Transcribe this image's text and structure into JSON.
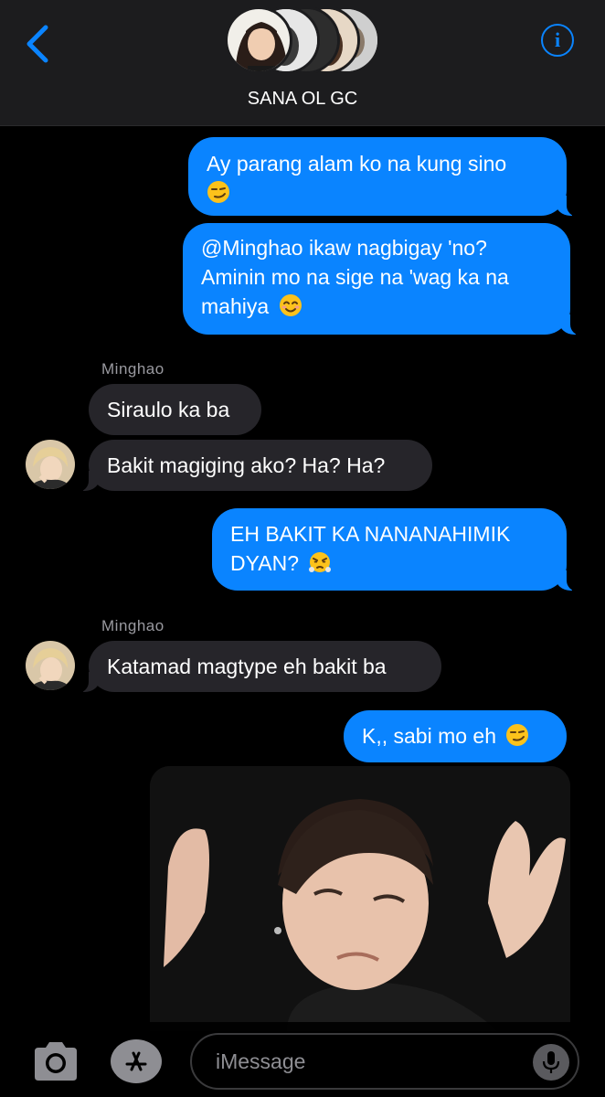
{
  "header": {
    "group_name": "SANA OL GC",
    "back_icon": "chevron-left-icon",
    "info_icon": "info-circle-icon",
    "accent": "#0a84ff"
  },
  "messages": [
    {
      "direction": "outgoing",
      "text": "Ay parang alam ko na kung sino",
      "emoji": "smirking-face"
    },
    {
      "direction": "outgoing",
      "lines": [
        "@Minghao ikaw nagbigay 'no?",
        "Aminin mo na sige na 'wag ka na",
        "mahiya"
      ],
      "emoji": "smiling-face-with-smiling-eyes"
    },
    {
      "direction": "incoming",
      "sender": "Minghao",
      "text": "Siraulo ka ba"
    },
    {
      "direction": "incoming",
      "text": "Bakit magiging ako? Ha? Ha?"
    },
    {
      "direction": "outgoing",
      "lines": [
        "EH BAKIT KA NANANAHIMIK",
        "DYAN?"
      ],
      "emoji": "face-with-steam-from-nose"
    },
    {
      "direction": "incoming",
      "sender": "Minghao",
      "text": "Katamad magtype eh bakit ba"
    },
    {
      "direction": "outgoing",
      "text": "K,, sabi mo eh",
      "emoji": "smirking-face"
    },
    {
      "direction": "outgoing",
      "type": "image",
      "description": "gif-attachment"
    }
  ],
  "input_bar": {
    "placeholder": "iMessage",
    "camera_icon": "camera-icon",
    "appstore_icon": "app-store-icon",
    "mic_icon": "microphone-icon"
  },
  "colors": {
    "outgoing_bubble": "#0a84ff",
    "incoming_bubble": "#26252a",
    "background": "#000000"
  }
}
